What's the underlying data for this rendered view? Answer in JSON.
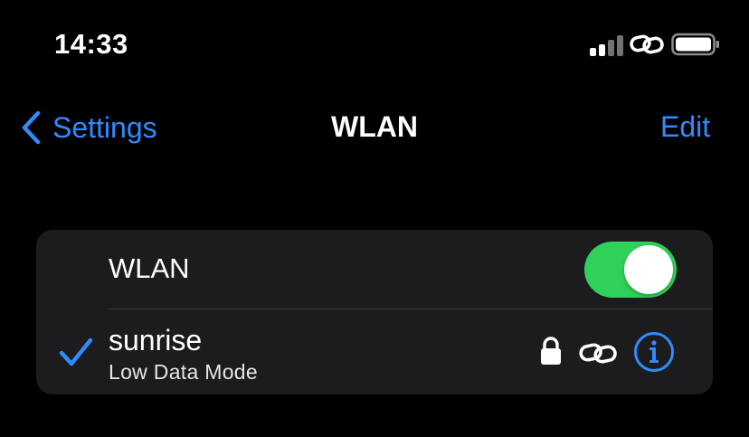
{
  "status_bar": {
    "time": "14:33",
    "icons": [
      "cellular-signal-icon",
      "wifi-link-icon",
      "battery-icon"
    ]
  },
  "nav": {
    "back_label": "Settings",
    "title": "WLAN",
    "edit_label": "Edit"
  },
  "wlan_toggle": {
    "label": "WLAN",
    "on": true
  },
  "current_network": {
    "name": "sunrise",
    "subtitle": "Low Data Mode",
    "connected": true,
    "icons": [
      "lock-icon",
      "link-icon",
      "info-icon"
    ]
  },
  "colors": {
    "background": "#000000",
    "card": "#1c1c1e",
    "accent": "#2f8cff",
    "toggle_on": "#30d158"
  }
}
